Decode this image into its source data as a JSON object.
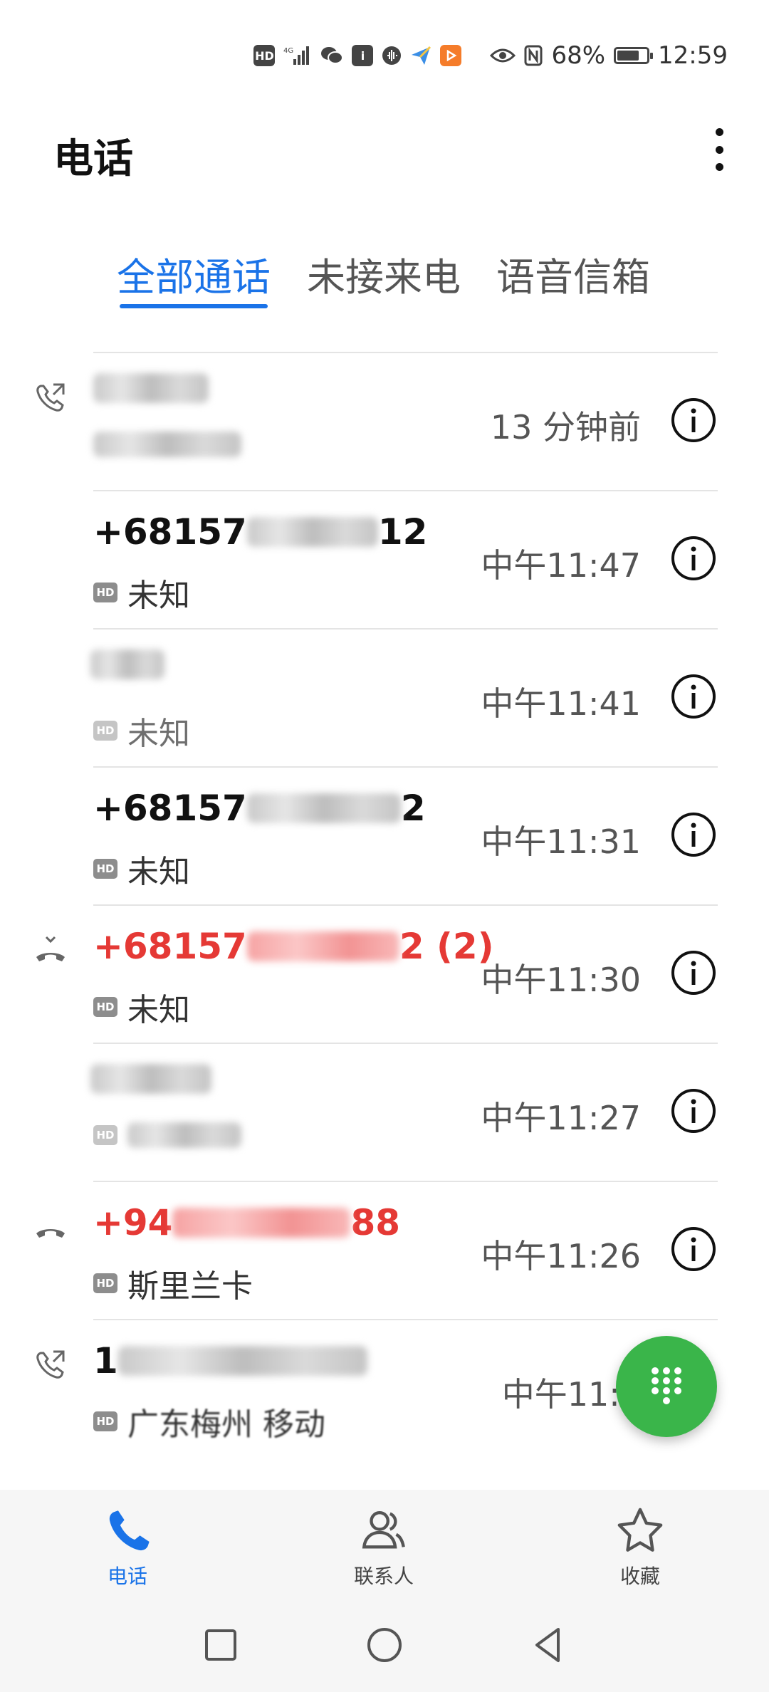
{
  "status_bar": {
    "hd_label": "HD",
    "network": "4G",
    "battery_percent_text": "68%",
    "battery_level": 0.68,
    "time": "12:59"
  },
  "header": {
    "title": "电话",
    "menu_icon": "more-vertical-icon"
  },
  "tabs": [
    {
      "label": "全部通话",
      "active": true
    },
    {
      "label": "未接来电",
      "active": false
    },
    {
      "label": "语音信箱",
      "active": false
    }
  ],
  "calls": [
    {
      "type": "outgoing",
      "name": "",
      "sub": "",
      "hd": false,
      "time": "13 分钟前",
      "missed": false
    },
    {
      "type": "incoming",
      "name_prefix": "+68157",
      "name_suffix": "12",
      "sub": "未知",
      "hd": true,
      "time": "中午11:47",
      "missed": false
    },
    {
      "type": "incoming",
      "name_prefix": "",
      "name_suffix": "",
      "sub": "未知",
      "hd": true,
      "time": "中午11:41",
      "missed": false
    },
    {
      "type": "incoming",
      "name_prefix": "+68157",
      "name_suffix": "2",
      "sub": "未知",
      "hd": true,
      "time": "中午11:31",
      "missed": false
    },
    {
      "type": "missed",
      "name_prefix": "+68157",
      "name_suffix": "2 (2)",
      "sub": "未知",
      "hd": true,
      "time": "中午11:30",
      "missed": true
    },
    {
      "type": "incoming",
      "name_prefix": "",
      "name_suffix": "",
      "sub": "",
      "hd": true,
      "time": "中午11:27",
      "missed": false
    },
    {
      "type": "missed",
      "name_prefix": "+94",
      "name_suffix": "88",
      "sub": "斯里兰卡",
      "hd": true,
      "time": "中午11:26",
      "missed": true
    },
    {
      "type": "outgoing",
      "name_prefix": "1",
      "name_suffix": "",
      "sub": "广东梅州 移动",
      "hd": true,
      "time": "中午11:1",
      "missed": false
    }
  ],
  "bottom_nav": [
    {
      "label": "电话",
      "icon": "phone-icon",
      "active": true
    },
    {
      "label": "联系人",
      "icon": "contacts-icon",
      "active": false
    },
    {
      "label": "收藏",
      "icon": "star-icon",
      "active": false
    }
  ],
  "colors": {
    "accent": "#1a73e8",
    "missed": "#e53935",
    "fab": "#3ab54a"
  }
}
